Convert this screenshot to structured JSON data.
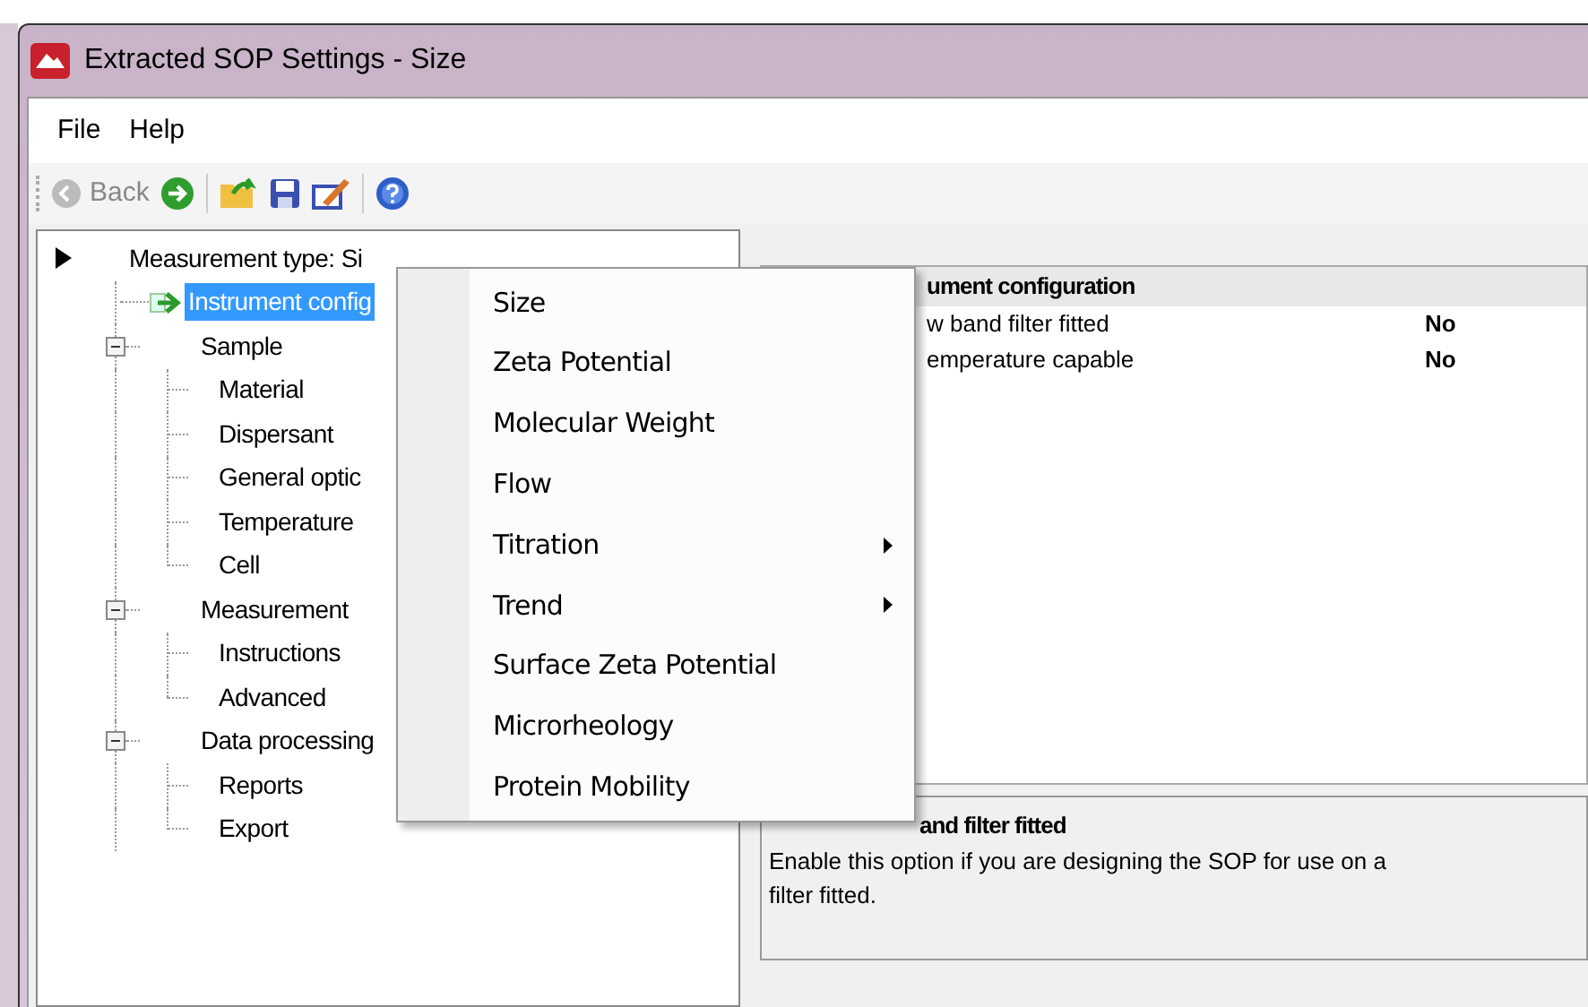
{
  "window": {
    "title": "Extracted SOP Settings - Size"
  },
  "menubar": [
    "File",
    "Help"
  ],
  "toolbar": {
    "back": {
      "label": "Back",
      "disabled": true
    }
  },
  "tree": [
    {
      "label": "Measurement type: Si",
      "kind": "root",
      "selected": false
    },
    {
      "label": "Instrument config",
      "kind": "leaf",
      "selected": true
    },
    {
      "label": "Sample",
      "kind": "group",
      "expanded": true,
      "selected": false,
      "children": [
        {
          "label": "Material",
          "selected": false
        },
        {
          "label": "Dispersant",
          "selected": false
        },
        {
          "label": "General optic",
          "selected": false
        },
        {
          "label": "Temperature",
          "selected": false
        },
        {
          "label": "Cell",
          "selected": false
        }
      ]
    },
    {
      "label": "Measurement",
      "kind": "group",
      "expanded": true,
      "selected": false,
      "children": [
        {
          "label": "Instructions",
          "selected": false
        },
        {
          "label": "Advanced",
          "selected": false
        }
      ]
    },
    {
      "label": "Data processing",
      "kind": "group",
      "expanded": true,
      "selected": false,
      "children": [
        {
          "label": "Reports",
          "selected": false
        },
        {
          "label": "Export",
          "selected": false
        }
      ]
    }
  ],
  "context_menu": [
    {
      "label": "Size",
      "submenu": false
    },
    {
      "label": "Zeta Potential",
      "submenu": false
    },
    {
      "label": "Molecular Weight",
      "submenu": false
    },
    {
      "label": "Flow",
      "submenu": false
    },
    {
      "label": "Titration",
      "submenu": true
    },
    {
      "label": "Trend",
      "submenu": true
    },
    {
      "label": "Surface Zeta Potential",
      "submenu": false
    },
    {
      "label": "Microrheology",
      "submenu": false
    },
    {
      "label": "Protein Mobility",
      "submenu": false
    }
  ],
  "properties": {
    "category": "ument configuration",
    "rows": [
      {
        "name": "w band filter fitted",
        "value": "No"
      },
      {
        "name": "emperature capable",
        "value": "No"
      }
    ]
  },
  "description": {
    "title": "and filter fitted",
    "text": "Enable this option if you are designing the SOP for use on a",
    "text_2": "filter fitted."
  }
}
